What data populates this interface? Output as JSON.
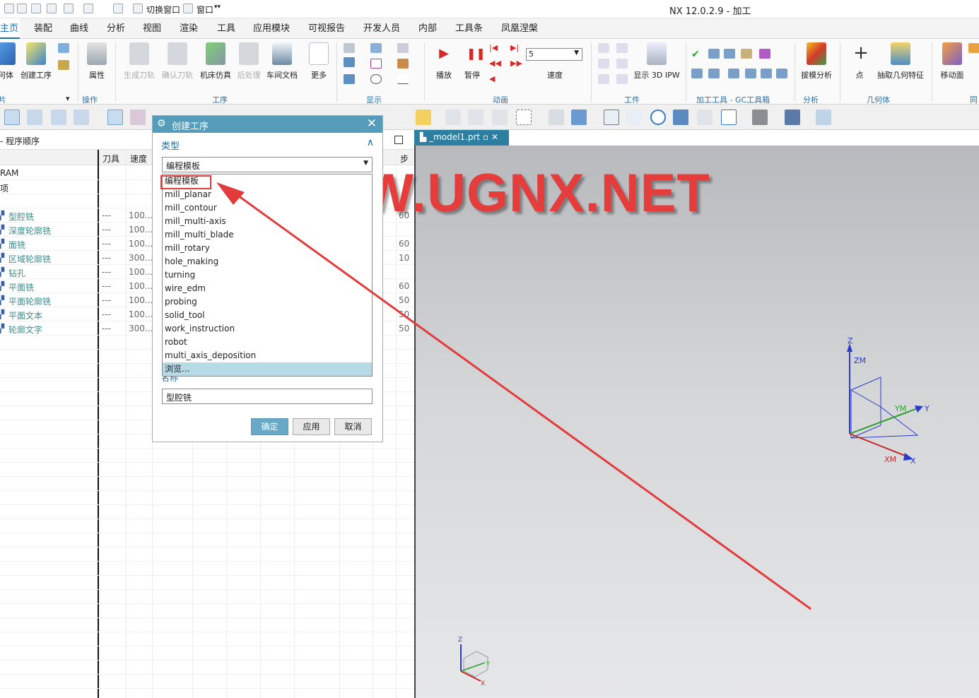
{
  "window": {
    "title": "NX 12.0.2.9 - 加工"
  },
  "quick_access": {
    "switch_window": "切换窗口",
    "window_menu": "窗口"
  },
  "menu_tabs": [
    "主页",
    "装配",
    "曲线",
    "分析",
    "视图",
    "渲染",
    "工具",
    "应用模块",
    "可视报告",
    "开发人员",
    "内部",
    "工具条",
    "凤凰涅槃"
  ],
  "ribbon": {
    "buttons": {
      "geometry": "何体",
      "create_op": "创建工序",
      "properties": "属性",
      "gen_toolpath": "生成刀轨",
      "verify_toolpath": "确认刀轨",
      "machine_sim": "机床仿真",
      "postprocess": "后处理",
      "shop_doc": "车间文档",
      "more": "更多",
      "play": "播放",
      "pause": "暂停",
      "speed": "速度",
      "show_ipw": "显示 3D IPW",
      "draft_analysis": "拔模分析",
      "point": "点",
      "extract_geom": "抽取几何特征",
      "move_face": "移动面"
    },
    "speed_value": "5",
    "groups": {
      "group1": "片",
      "ops": "操作",
      "procedure": "工序",
      "display": "显示",
      "animation": "动画",
      "workpiece": "工件",
      "gc_tools": "加工工具 - GC工具箱",
      "analysis": "分析",
      "geometry": "几何体",
      "sync": "同"
    }
  },
  "navigator": {
    "title": "- 程序顺序",
    "columns": {
      "tool": "刀具",
      "speed": "速度",
      "step": "步"
    },
    "program_rows": [
      "RAM",
      "项"
    ],
    "operations": [
      {
        "name": "型腔铣",
        "tool": "---",
        "speed": "100...",
        "step": "60"
      },
      {
        "name": "深度轮廓铣",
        "tool": "---",
        "speed": "100...",
        "step": ""
      },
      {
        "name": "面铣",
        "tool": "---",
        "speed": "100...",
        "step": "60"
      },
      {
        "name": "区域轮廓铣",
        "tool": "---",
        "speed": "300...",
        "step": "10"
      },
      {
        "name": "钻孔",
        "tool": "---",
        "speed": "100...",
        "step": ""
      },
      {
        "name": "平面铣",
        "tool": "---",
        "speed": "100...",
        "step": "60"
      },
      {
        "name": "平面轮廓铣",
        "tool": "---",
        "speed": "100...",
        "step": "50"
      },
      {
        "name": "平面文本",
        "tool": "---",
        "speed": "100...",
        "step": "50"
      },
      {
        "name": "轮廓文字",
        "tool": "---",
        "speed": "300...",
        "step": "50"
      }
    ]
  },
  "viewport": {
    "tab": "_model1.prt",
    "watermark": "WWW.UGNX.NET"
  },
  "csys": {
    "z": "Z",
    "zm": "ZM",
    "ym": "YM",
    "y": "Y",
    "xm": "XM",
    "x": "X"
  },
  "mini_csys": {
    "z": "Z",
    "y": "Y",
    "x": "X"
  },
  "dialog": {
    "title": "创建工序",
    "type_section": "类型",
    "type_value": "编程模板",
    "type_options": [
      "编程模板",
      "mill_planar",
      "mill_contour",
      "mill_multi-axis",
      "mill_multi_blade",
      "mill_rotary",
      "hole_making",
      "turning",
      "wire_edm",
      "probing",
      "solid_tool",
      "work_instruction",
      "robot",
      "multi_axis_deposition",
      "浏览..."
    ],
    "name_section": "名称",
    "name_value": "型腔铣",
    "ok": "确定",
    "apply": "应用",
    "cancel": "取消"
  },
  "colors": {
    "accent": "#1b6db8",
    "dialog_title": "#559cba",
    "highlight": "#e23b3b",
    "op_text": "#3d8b8b"
  }
}
